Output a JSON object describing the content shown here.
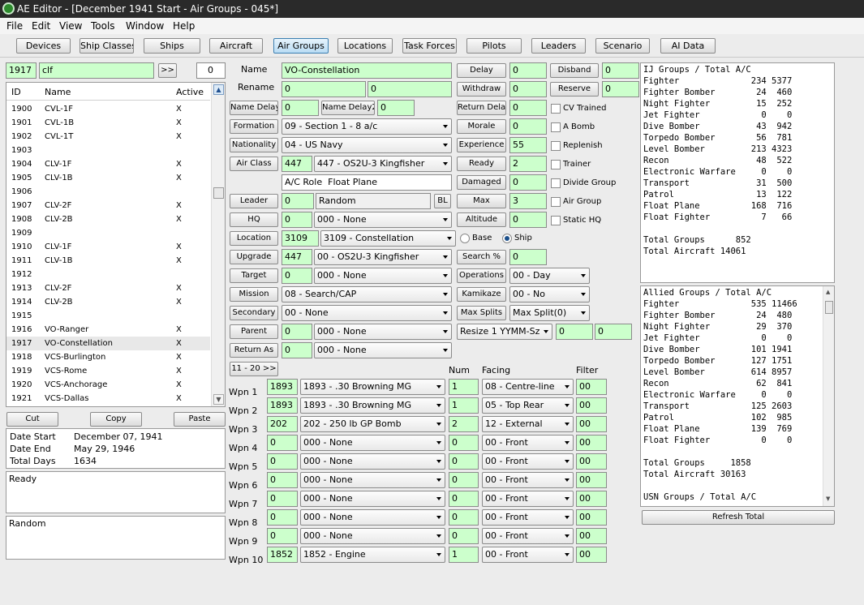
{
  "window": {
    "title": "AE Editor - [December 1941 Start - Air Groups - 045*]"
  },
  "menu": [
    "File",
    "Edit",
    "View",
    "Tools",
    "Window",
    "Help"
  ],
  "tabs": [
    "Devices",
    "Ship Classes",
    "Ships",
    "Aircraft",
    "Air Groups",
    "Locations",
    "Task Forces",
    "Pilots",
    "Leaders",
    "Scenario",
    "AI Data"
  ],
  "search": {
    "id": "1917",
    "text": "clf",
    "next": ">>",
    "count": "0"
  },
  "list": {
    "headers": [
      "ID",
      "Name",
      "Active"
    ],
    "rows": [
      [
        "1900",
        "CVL-1F",
        "X"
      ],
      [
        "1901",
        "CVL-1B",
        "X"
      ],
      [
        "1902",
        "CVL-1T",
        "X"
      ],
      [
        "1903",
        "",
        ""
      ],
      [
        "1904",
        "CLV-1F",
        "X"
      ],
      [
        "1905",
        "CLV-1B",
        "X"
      ],
      [
        "1906",
        "",
        ""
      ],
      [
        "1907",
        "CLV-2F",
        "X"
      ],
      [
        "1908",
        "CLV-2B",
        "X"
      ],
      [
        "1909",
        "",
        ""
      ],
      [
        "1910",
        "CLV-1F",
        "X"
      ],
      [
        "1911",
        "CLV-1B",
        "X"
      ],
      [
        "1912",
        "",
        ""
      ],
      [
        "1913",
        "CLV-2F",
        "X"
      ],
      [
        "1914",
        "CLV-2B",
        "X"
      ],
      [
        "1915",
        "",
        ""
      ],
      [
        "1916",
        "VO-Ranger",
        "X"
      ],
      [
        "1917",
        "VO-Constellation",
        "X"
      ],
      [
        "1918",
        "VCS-Burlington",
        "X"
      ],
      [
        "1919",
        "VCS-Rome",
        "X"
      ],
      [
        "1920",
        "VCS-Anchorage",
        "X"
      ],
      [
        "1921",
        "VCS-Dallas",
        "X"
      ]
    ],
    "selected_index": 17
  },
  "clip": {
    "cut": "Cut",
    "copy": "Copy",
    "paste": "Paste"
  },
  "dates": {
    "start_label": "Date Start",
    "start": "December 07, 1941",
    "end_label": "Date End",
    "end": "May 29, 1946",
    "days_label": "Total Days",
    "days": "1634"
  },
  "status": "Ready",
  "random_text": "Random",
  "form": {
    "name_label": "Name",
    "name": "VO-Constellation",
    "rename_label": "Rename",
    "rename1": "0",
    "rename2": "0",
    "name_delay_label": "Name Delay",
    "name_delay": "0",
    "name_delay2_label": "Name Delay2",
    "name_delay2": "0",
    "formation_label": "Formation",
    "formation": "09 - Section 1 - 8 a/c",
    "nationality_label": "Nationality",
    "nationality": "04 - US Navy",
    "air_class_label": "Air Class",
    "air_class_id": "447",
    "air_class": "447 - OS2U-3 Kingfisher",
    "ac_role_label": "A/C Role",
    "ac_role": "Float Plane",
    "leader_label": "Leader",
    "leader_id": "0",
    "leader": "Random",
    "bl": "BL",
    "hq_label": "HQ",
    "hq_id": "0",
    "hq": "000 - None",
    "location_label": "Location",
    "location_id": "3109",
    "location": "3109 - Constellation",
    "upgrade_label": "Upgrade",
    "upgrade_id": "447",
    "upgrade": "00 - OS2U-3 Kingfisher",
    "target_label": "Target",
    "target_id": "0",
    "target": "000 - None",
    "mission_label": "Mission",
    "mission": "08 - Search/CAP",
    "secondary_label": "Secondary",
    "secondary": "00 - None",
    "parent_label": "Parent",
    "parent_id": "0",
    "parent": "000 - None",
    "return_as_label": "Return As",
    "return_as_id": "0",
    "return_as": "000 - None",
    "page_label": "11 - 20 >>"
  },
  "right": {
    "delay_label": "Delay",
    "delay": "0",
    "disband_label": "Disband",
    "disband": "0",
    "withdraw_label": "Withdraw",
    "withdraw": "0",
    "reserve_label": "Reserve",
    "reserve": "0",
    "return_delay_label": "Return Delay",
    "return_delay": "0",
    "morale_label": "Morale",
    "morale": "0",
    "experience_label": "Experience",
    "experience": "55",
    "ready_label": "Ready",
    "ready": "2",
    "damaged_label": "Damaged",
    "damaged": "0",
    "max_label": "Max",
    "max": "3",
    "altitude_label": "Altitude",
    "altitude": "0",
    "search_label": "Search %",
    "search": "0",
    "operations_label": "Operations",
    "operations": "00 - Day",
    "kamikaze_label": "Kamikaze",
    "kamikaze": "00 - No",
    "max_splits_label": "Max Splits",
    "max_splits": "Max Split(0)",
    "resize": "Resize 1 YYMM-Sz",
    "resize_a": "0",
    "resize_b": "0",
    "checks": [
      "CV Trained",
      "A Bomb",
      "Replenish",
      "Trainer",
      "Divide Group",
      "Air Group",
      "Static HQ"
    ],
    "base_label": "Base",
    "ship_label": "Ship"
  },
  "weapons": {
    "headers": {
      "num": "Num",
      "facing": "Facing",
      "filter": "Filter"
    },
    "rows": [
      {
        "label": "Wpn 1",
        "id": "1893",
        "name": "1893 - .30 Browning MG",
        "num": "1",
        "facing": "08 - Centre-line",
        "filter": "00"
      },
      {
        "label": "Wpn 2",
        "id": "1893",
        "name": "1893 - .30 Browning MG",
        "num": "1",
        "facing": "05 - Top Rear",
        "filter": "00"
      },
      {
        "label": "Wpn 3",
        "id": "202",
        "name": "202 - 250 lb GP Bomb",
        "num": "2",
        "facing": "12 - External",
        "filter": "00"
      },
      {
        "label": "Wpn 4",
        "id": "0",
        "name": "000 - None",
        "num": "0",
        "facing": "00 - Front",
        "filter": "00"
      },
      {
        "label": "Wpn 5",
        "id": "0",
        "name": "000 - None",
        "num": "0",
        "facing": "00 - Front",
        "filter": "00"
      },
      {
        "label": "Wpn 6",
        "id": "0",
        "name": "000 - None",
        "num": "0",
        "facing": "00 - Front",
        "filter": "00"
      },
      {
        "label": "Wpn 7",
        "id": "0",
        "name": "000 - None",
        "num": "0",
        "facing": "00 - Front",
        "filter": "00"
      },
      {
        "label": "Wpn 8",
        "id": "0",
        "name": "000 - None",
        "num": "0",
        "facing": "00 - Front",
        "filter": "00"
      },
      {
        "label": "Wpn 9",
        "id": "0",
        "name": "000 - None",
        "num": "0",
        "facing": "00 - Front",
        "filter": "00"
      },
      {
        "label": "Wpn 10",
        "id": "1852",
        "name": "1852 - Engine",
        "num": "1",
        "facing": "00 - Front",
        "filter": "00"
      }
    ]
  },
  "totals": {
    "ij": "IJ Groups / Total A/C\nFighter              234 5377\nFighter Bomber        24  460\nNight Fighter         15  252\nJet Fighter            0    0\nDive Bomber           43  942\nTorpedo Bomber        56  781\nLevel Bomber         213 4323\nRecon                 48  522\nElectronic Warfare     0    0\nTransport             31  500\nPatrol                13  122\nFloat Plane          168  716\nFloat Fighter          7   66\n\nTotal Groups      852\nTotal Aircraft 14061",
    "allied": "Allied Groups / Total A/C\nFighter              535 11466\nFighter Bomber        24  480\nNight Fighter         29  370\nJet Fighter            0    0\nDive Bomber          101 1941\nTorpedo Bomber       127 1751\nLevel Bomber         614 8957\nRecon                 62  841\nElectronic Warfare     0    0\nTransport            125 2603\nPatrol               102  985\nFloat Plane          139  769\nFloat Fighter          0    0\n\nTotal Groups     1858\nTotal Aircraft 30163\n\nUSN Groups / Total A/C",
    "refresh": "Refresh Total"
  }
}
